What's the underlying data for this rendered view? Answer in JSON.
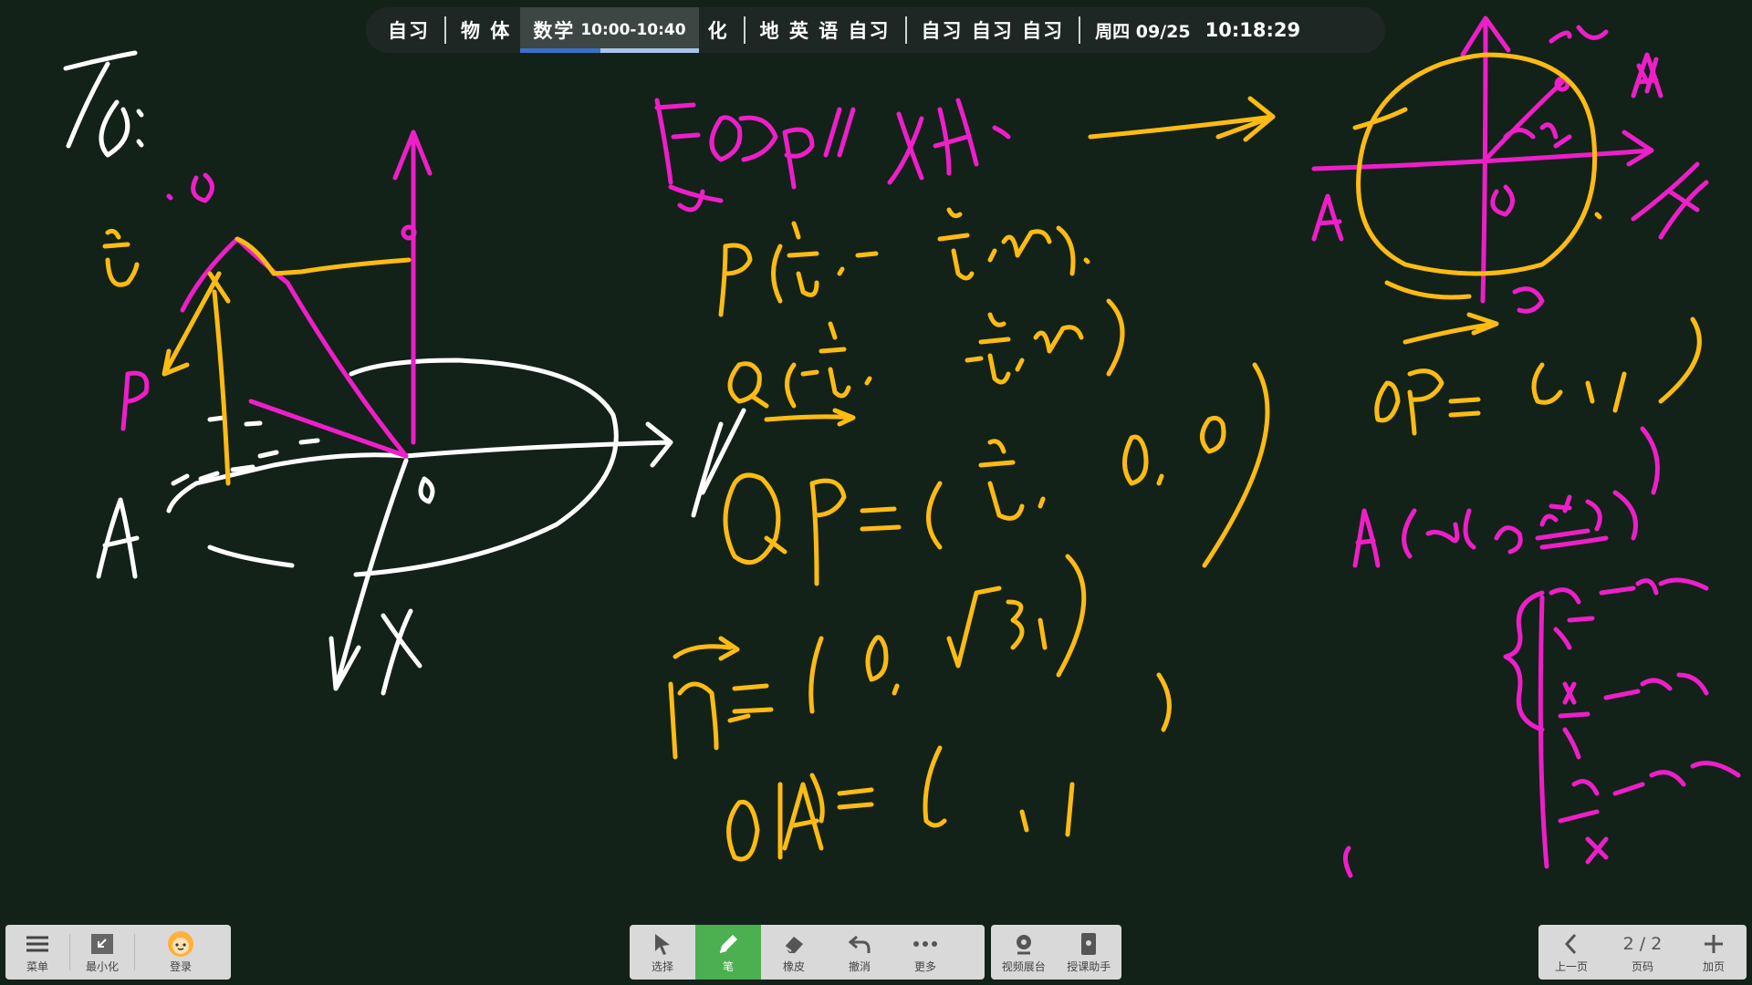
{
  "schedule": {
    "items_before": [
      "自习",
      "物 体"
    ],
    "current": {
      "subject": "数学",
      "time": "10:00-10:40",
      "progress": 0.45
    },
    "items_after_a": [
      "化"
    ],
    "items_after_b": [
      "地 英 语 自习"
    ],
    "items_after_c": [
      "自习 自习 自习"
    ],
    "date": "周四 09/25",
    "clock": "10:18:29"
  },
  "board": {
    "page_current": 2,
    "page_total": 2,
    "ink_colors": {
      "white": "#ffffff",
      "magenta": "#ee1ec8",
      "orange": "#ffbb12"
    },
    "handwriting": {
      "top_left": "16: 设Z..",
      "axis_z": "Z.",
      "o1": "O1",
      "p_label": "P",
      "a_label": "A",
      "o_label": "O",
      "x_label": "X",
      "y_label": "y",
      "magenta_top": "取OP // X轴.",
      "line1": "P(-1/√3 , -5/3 , √3).",
      "line2": "Q(-1/√3 , -5/3 , √3)",
      "line3": "QP =( 2/√3 , 0 , 0)",
      "line4": "n =( 0 , √3 ,1)",
      "line5": "O1A =(  ,  ,  )",
      "right_op": "OP =(  ,  ,  )",
      "right_a": "A(cosα , sinα , 0)",
      "right_brace1": "y/r = sinα",
      "right_brace2": "x/r = cosα",
      "right_brace3": "y/x = tanα",
      "circle_a": "A",
      "circle_alpha": "α"
    }
  },
  "toolbar_left": {
    "menu": "菜单",
    "minimize": "最小化",
    "login": "登录"
  },
  "toolbar_center": {
    "select": "选择",
    "pen": "笔",
    "eraser": "橡皮",
    "undo": "撤消",
    "more": "更多"
  },
  "toolbar_extra": {
    "video": "视频展台",
    "assistant": "授课助手"
  },
  "toolbar_right": {
    "prev": "上一页",
    "page_label": "页码",
    "page_text": "2 / 2",
    "add": "加页"
  }
}
